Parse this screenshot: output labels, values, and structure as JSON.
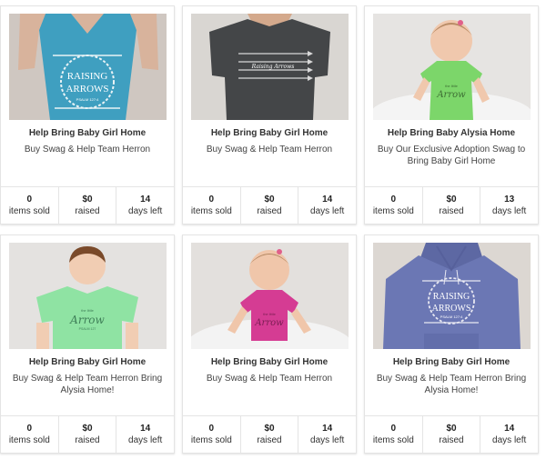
{
  "cards": [
    {
      "title": "Help Bring Baby Girl Home",
      "description": "Buy Swag & Help Team Herron",
      "product": "teal-vneck-raising-arrows",
      "image_text": [
        "RAISING",
        "ARROWS",
        "PSALM 127:4"
      ],
      "stats": {
        "sold": "0",
        "sold_label": "items sold",
        "raised": "$0",
        "raised_label": "raised",
        "days": "14",
        "days_label": "days left"
      }
    },
    {
      "title": "Help Bring Baby Girl Home",
      "description": "Buy Swag & Help Team Herron",
      "product": "charcoal-tee-arrows",
      "image_text": [
        "Raising Arrows"
      ],
      "stats": {
        "sold": "0",
        "sold_label": "items sold",
        "raised": "$0",
        "raised_label": "raised",
        "days": "14",
        "days_label": "days left"
      }
    },
    {
      "title": "Help Bring Baby Alysia Home",
      "description": "Buy Our Exclusive Adoption Swag to Bring Baby Girl Home",
      "product": "green-onesie-little-arrow",
      "image_text": [
        "the little",
        "Arrow"
      ],
      "stats": {
        "sold": "0",
        "sold_label": "items sold",
        "raised": "$0",
        "raised_label": "raised",
        "days": "13",
        "days_label": "days left"
      }
    },
    {
      "title": "Help Bring Baby Girl Home",
      "description": "Buy Swag & Help Team Herron Bring Alysia Home!",
      "product": "green-kids-tee-little-arrow",
      "image_text": [
        "the little",
        "Arrow",
        "PSALM 127"
      ],
      "stats": {
        "sold": "0",
        "sold_label": "items sold",
        "raised": "$0",
        "raised_label": "raised",
        "days": "14",
        "days_label": "days left"
      }
    },
    {
      "title": "Help Bring Baby Girl Home",
      "description": "Buy Swag & Help Team Herron",
      "product": "pink-onesie-little-arrow",
      "image_text": [
        "the little",
        "Arrow"
      ],
      "stats": {
        "sold": "0",
        "sold_label": "items sold",
        "raised": "$0",
        "raised_label": "raised",
        "days": "14",
        "days_label": "days left"
      }
    },
    {
      "title": "Help Bring Baby Girl Home",
      "description": "Buy Swag & Help Team Herron Bring Alysia Home!",
      "product": "heather-blue-hoodie-raising-arrows",
      "image_text": [
        "RAISING",
        "ARROWS",
        "PSALM 127:4"
      ],
      "stats": {
        "sold": "0",
        "sold_label": "items sold",
        "raised": "$0",
        "raised_label": "raised",
        "days": "14",
        "days_label": "days left"
      }
    }
  ],
  "colors": {
    "teal_shirt": "#3f9fc0",
    "charcoal_shirt": "#444648",
    "green_onesie": "#7cd66a",
    "mint_tee": "#8fe3a3",
    "pink_onesie": "#d53c93",
    "heather_blue_hoodie": "#6b77b4",
    "divider": "#e4e4e4"
  }
}
